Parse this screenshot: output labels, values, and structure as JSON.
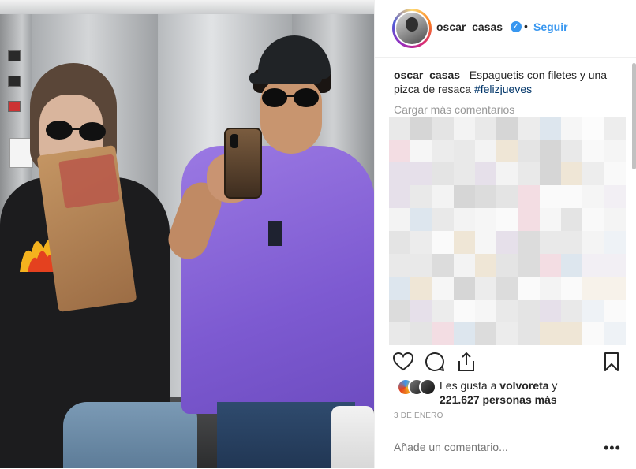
{
  "post": {
    "image_alt": "Selfie en el ascensor",
    "header": {
      "username": "oscar_casas_",
      "verified_icon": "verified-badge-icon",
      "separator": "•",
      "follow_label": "Seguir"
    },
    "caption": {
      "username": "oscar_casas_",
      "text": "Espaguetis con filetes y una pizca de resaca",
      "hashtag": "#felizjueves"
    },
    "load_more_label": "Cargar más comentarios",
    "actions": {
      "like_icon": "heart-icon",
      "comment_icon": "comment-icon",
      "share_icon": "share-icon",
      "save_icon": "bookmark-icon"
    },
    "likes": {
      "prefix": "Les gusta a",
      "user": "volvoreta",
      "connector": "y",
      "count": "221.627 personas más"
    },
    "date": "3 DE ENERO",
    "comment_box": {
      "placeholder": "Añade un comentario...",
      "more_label": "•••"
    }
  },
  "colors": {
    "accent": "#3897f0",
    "text": "#262626",
    "muted": "#999999",
    "hashtag": "#003569",
    "shirt": "#8e6ad8"
  }
}
